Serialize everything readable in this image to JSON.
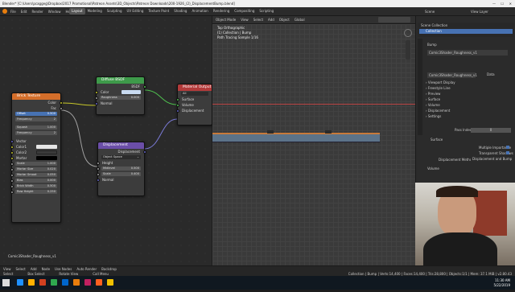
{
  "titlebar": {
    "text": "Blender* [C:\\Users\\pcaggeg\\Dropbox\\2017 Promotional\\Patreon Assets\\3D_Objects\\Patreon Downloads\\200-1926_(2)_DisplacementBump.blend]"
  },
  "menubar": {
    "menus": [
      "File",
      "Edit",
      "Render",
      "Window",
      "Help"
    ],
    "workspaces": [
      "Layout",
      "Modeling",
      "Sculpting",
      "UV Editing",
      "Texture Paint",
      "Shading",
      "Animation",
      "Rendering",
      "Compositing",
      "Scripting"
    ],
    "active_workspace": "Layout",
    "scene": "Scene",
    "view_layer": "View Layer"
  },
  "node_editor": {
    "header_items": [
      "Object",
      "View",
      "Select",
      "Add",
      "Node",
      "Use Nodes",
      "Slot 1"
    ],
    "material": "Comic3Shader_Roug",
    "footer_material": "Comic3Shader_Roughness_v1",
    "nodes": {
      "brick": {
        "title": "Brick Texture",
        "outputs": [
          "Color",
          "Fac"
        ],
        "offset_label": "Offset",
        "offset_value": "0.500",
        "frequency_label": "Frequency",
        "frequency_value": "2",
        "squash_label": "Squash",
        "squash_value": "1.000",
        "squash_freq_label": "Frequency",
        "squash_freq_value": "2",
        "inputs": [
          "Vector",
          "Color1",
          "Color2",
          "Mortar"
        ],
        "scale_label": "Scale",
        "scale_value": "1.000",
        "mortar_size_label": "Mortar Size",
        "mortar_size_value": "0.020",
        "mortar_smooth_label": "Mortar Smoot",
        "mortar_smooth_value": "0.050",
        "bias_label": "Bias",
        "bias_value": "0.000",
        "brick_width_label": "Brick Width",
        "brick_width_value": "0.500",
        "row_height_label": "Row Height",
        "row_height_value": "0.250"
      },
      "diffuse": {
        "title": "Diffuse BSDF",
        "output": "BSDF",
        "color_label": "Color",
        "roughness_label": "Roughness",
        "roughness_value": "0.000",
        "normal_label": "Normal"
      },
      "output": {
        "title": "Material Output",
        "target": "All",
        "inputs": [
          "Surface",
          "Volume",
          "Displacement"
        ]
      },
      "displacement": {
        "title": "Displacement",
        "output": "Displacement",
        "space": "Object Space",
        "inputs": [
          "Height"
        ],
        "midlevel_label": "Midlevel",
        "midlevel_value": "0.500",
        "scale_label": "Scale",
        "scale_value": "0.400",
        "normal_label": "Normal"
      }
    }
  },
  "viewport": {
    "header_items": [
      "Object Mode",
      "View",
      "Select",
      "Add",
      "Object",
      "Global"
    ],
    "overlay_lines": [
      "Top Orthographic",
      "(1) Collection | Bump",
      "Path Tracing Sample 1/16"
    ]
  },
  "properties": {
    "outliner_title": "Scene Collection",
    "outliner_item": "Collection",
    "object_name": "Bump",
    "material_slot": "Comic3Shader_Roughness_v1",
    "material_field": "Comic3Shader_Roughness_v1",
    "data_label": "Data",
    "sections": [
      "Viewport Display",
      "Freestyle Line",
      "Preview",
      "Surface",
      "Volume",
      "Displacement",
      "Settings"
    ],
    "pass_index_label": "Pass Index",
    "pass_index_value": "0",
    "surface_label": "Surface",
    "multiple_importance_label": "Multiple Importance",
    "transparent_shadows_label": "Transparent Shadows",
    "displacement_method_label": "Displacement Method",
    "displacement_method_value": "Displacement and Bump",
    "volume_label": "Volume"
  },
  "statusbar": {
    "left_items": [
      "Select",
      "Box Select",
      "Rotate View",
      "Call Menu"
    ],
    "node_header_items": [
      "View",
      "Select",
      "Add",
      "Node",
      "Use Nodes",
      "Auto Render",
      "Backdrop"
    ],
    "stats": "Collection | Bump | Verts:14,400 | Faces:14,400 | Tris:28,800 | Objects:1/1 | Mem: 37.1 MiB | v2.80.43"
  },
  "taskbar": {
    "time": "11:30 AM",
    "date": "5/22/2019",
    "colors": [
      "#1e90ff",
      "#ffb000",
      "#d04020",
      "#2fa84f",
      "#0066cc",
      "#e87d0d",
      "#c02060",
      "#ff6020",
      "#f0c000"
    ]
  },
  "webcam": {
    "label": ""
  }
}
